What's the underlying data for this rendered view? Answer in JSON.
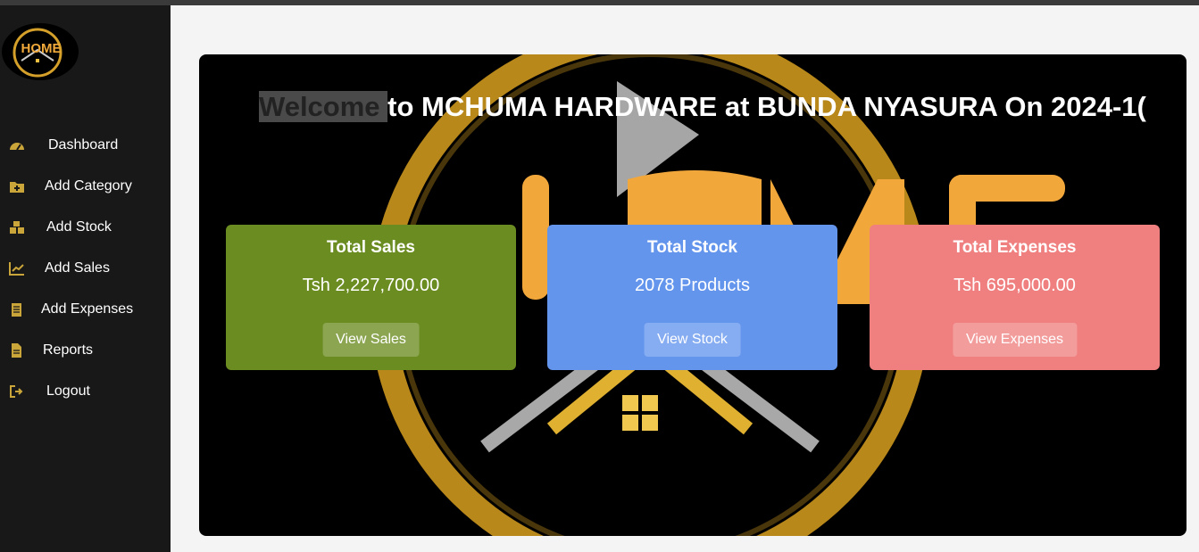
{
  "colors": {
    "sidebar_bg": "#181818",
    "page_bg": "#f4f4f4",
    "icon_gold": "#c9a53a",
    "sales_card": "#6b8c21",
    "stock_card": "#6495ed",
    "expenses_card": "#f08080"
  },
  "logo": {
    "text": "HOME"
  },
  "sidebar": {
    "items": [
      {
        "label": "Dashboard",
        "icon": "dashboard-gauge-icon"
      },
      {
        "label": "Add Category",
        "icon": "folder-plus-icon"
      },
      {
        "label": "Add Stock",
        "icon": "boxes-icon"
      },
      {
        "label": "Add Sales",
        "icon": "line-chart-icon"
      },
      {
        "label": "Add Expenses",
        "icon": "clipboard-icon"
      },
      {
        "label": "Reports",
        "icon": "file-text-icon"
      },
      {
        "label": "Logout",
        "icon": "sign-out-icon"
      }
    ]
  },
  "welcome": {
    "highlight": "Welcome ",
    "rest": "to MCHUMA HARDWARE at BUNDA NYASURA On 2024-1("
  },
  "cards": {
    "sales": {
      "title": "Total Sales",
      "value": "Tsh 2,227,700.00",
      "button": "View Sales"
    },
    "stock": {
      "title": "Total Stock",
      "value": "2078 Products",
      "button": "View Stock"
    },
    "expenses": {
      "title": "Total Expenses",
      "value": "Tsh 695,000.00",
      "button": "View Expenses"
    }
  }
}
